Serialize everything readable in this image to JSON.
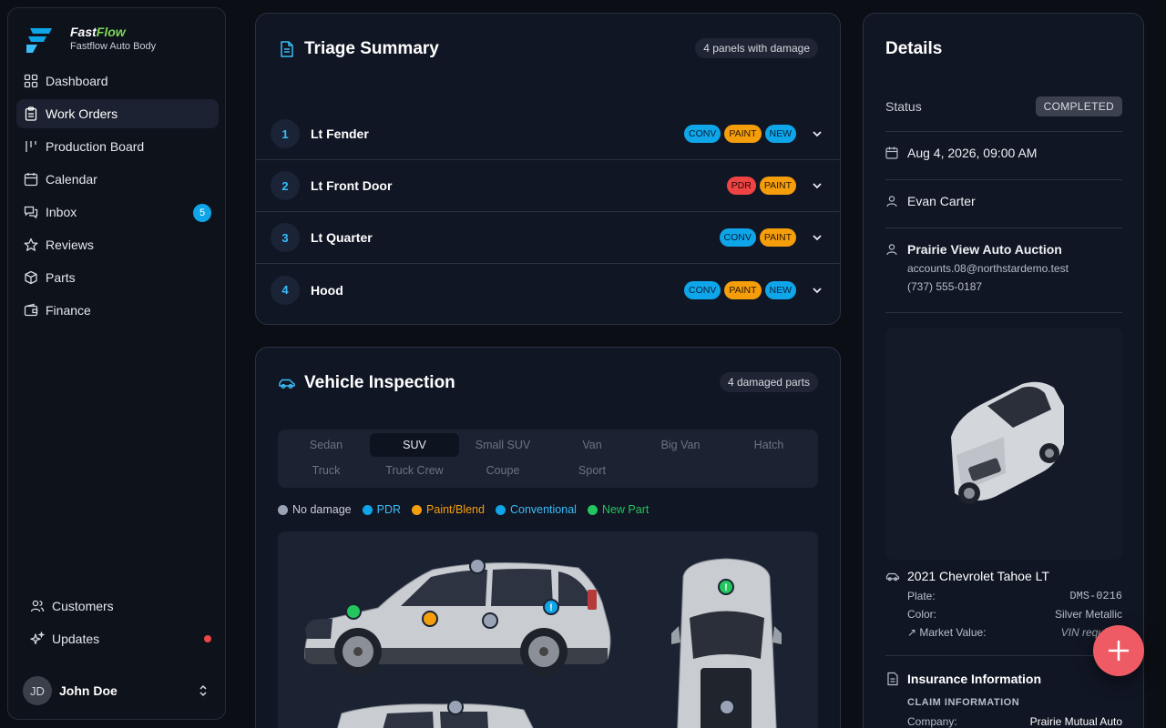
{
  "brand": {
    "name_part1": "Fast",
    "name_part2": "Flow",
    "subtitle": "Fastflow Auto Body"
  },
  "nav": {
    "items": [
      {
        "label": "Dashboard",
        "icon": "dashboard-icon"
      },
      {
        "label": "Work Orders",
        "icon": "clipboard-icon",
        "active": true
      },
      {
        "label": "Production Board",
        "icon": "kanban-icon"
      },
      {
        "label": "Calendar",
        "icon": "calendar-icon"
      },
      {
        "label": "Inbox",
        "icon": "chat-icon",
        "badge": "5"
      },
      {
        "label": "Reviews",
        "icon": "star-icon"
      },
      {
        "label": "Parts",
        "icon": "box-icon"
      },
      {
        "label": "Finance",
        "icon": "wallet-icon"
      }
    ],
    "bottom": [
      {
        "label": "Customers",
        "icon": "users-icon"
      },
      {
        "label": "Updates",
        "icon": "sparkles-icon",
        "dot": true
      }
    ]
  },
  "user": {
    "initials": "JD",
    "name": "John Doe"
  },
  "triage": {
    "title": "Triage Summary",
    "count_label": "4 panels with damage",
    "rows": [
      {
        "num": "1",
        "label": "Lt Fender",
        "tags": [
          "CONV",
          "PAINT",
          "NEW"
        ]
      },
      {
        "num": "2",
        "label": "Lt Front Door",
        "tags": [
          "PDR",
          "PAINT"
        ]
      },
      {
        "num": "3",
        "label": "Lt Quarter",
        "tags": [
          "CONV",
          "PAINT"
        ]
      },
      {
        "num": "4",
        "label": "Hood",
        "tags": [
          "CONV",
          "PAINT",
          "NEW"
        ]
      }
    ]
  },
  "inspection": {
    "title": "Vehicle Inspection",
    "count_label": "4 damaged parts",
    "types": [
      "Sedan",
      "SUV",
      "Small SUV",
      "Van",
      "Big Van",
      "Hatch",
      "Truck",
      "Truck Crew",
      "Coupe",
      "Sport"
    ],
    "active_type": "SUV",
    "legend": [
      {
        "label": "No damage",
        "color": "#9aa3b5"
      },
      {
        "label": "PDR",
        "color": "#0ea5e9"
      },
      {
        "label": "Paint/Blend",
        "color": "#f59e0b"
      },
      {
        "label": "Conventional",
        "color": "#0ea5e9"
      },
      {
        "label": "New Part",
        "color": "#22c55e"
      }
    ]
  },
  "details": {
    "title": "Details",
    "status_label": "Status",
    "status_value": "COMPLETED",
    "date": "Aug 4, 2026, 09:00 AM",
    "assignee": "Evan Carter",
    "customer_name": "Prairie View Auto Auction",
    "customer_email": "accounts.08@northstardemo.test",
    "customer_phone": "(737) 555-0187",
    "vehicle": {
      "title": "2021 Chevrolet Tahoe LT",
      "plate_label": "Plate:",
      "plate": "DMS-0216",
      "color_label": "Color:",
      "color": "Silver Metallic",
      "market_label": "Market Value:",
      "market_value": "VIN required"
    },
    "insurance": {
      "title": "Insurance Information",
      "claim_label": "CLAIM INFORMATION",
      "company_label": "Company:",
      "company": "Prairie Mutual Auto"
    }
  },
  "colors": {
    "accent": "#0ea5e9",
    "fab": "#ef5b64",
    "background": "#0b0e14"
  }
}
